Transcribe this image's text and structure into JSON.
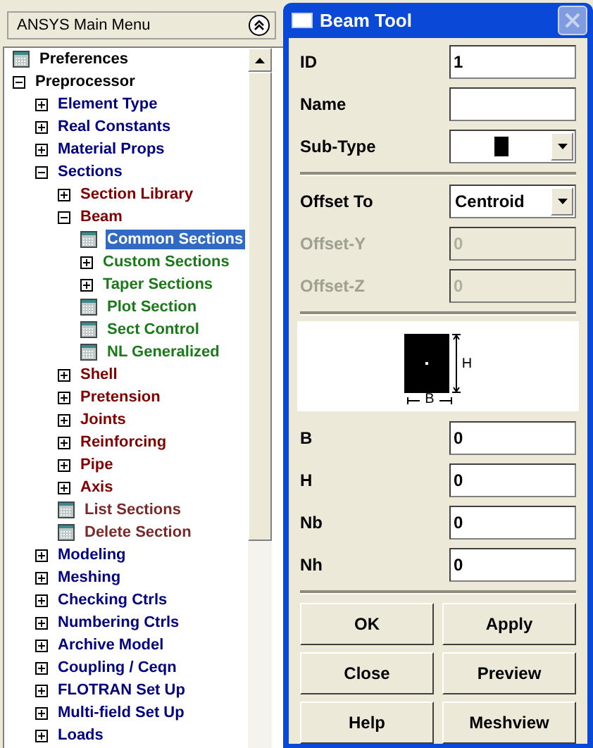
{
  "main_menu": {
    "title": "ANSYS Main Menu",
    "tree": [
      {
        "label": "Preferences",
        "kind": "action",
        "color": "#000000",
        "selected": false
      },
      {
        "label": "Preprocessor",
        "kind": "folder",
        "expanded": true,
        "color": "#000000",
        "selected": false,
        "children": [
          {
            "label": "Element Type",
            "kind": "folder",
            "expanded": false,
            "color": "#000080",
            "selected": false
          },
          {
            "label": "Real Constants",
            "kind": "folder",
            "expanded": false,
            "color": "#000080",
            "selected": false
          },
          {
            "label": "Material Props",
            "kind": "folder",
            "expanded": false,
            "color": "#000080",
            "selected": false
          },
          {
            "label": "Sections",
            "kind": "folder",
            "expanded": true,
            "color": "#000080",
            "selected": false,
            "children": [
              {
                "label": "Section Library",
                "kind": "folder",
                "expanded": false,
                "color": "#800000",
                "selected": false
              },
              {
                "label": "Beam",
                "kind": "folder",
                "expanded": true,
                "color": "#800000",
                "selected": false,
                "children": [
                  {
                    "label": "Common Sections",
                    "kind": "action",
                    "selected": true
                  },
                  {
                    "label": "Custom Sections",
                    "kind": "folder",
                    "expanded": false,
                    "color": "#1a7a1a",
                    "selected": false
                  },
                  {
                    "label": "Taper Sections",
                    "kind": "folder",
                    "expanded": false,
                    "color": "#1a7a1a",
                    "selected": false
                  },
                  {
                    "label": "Plot Section",
                    "kind": "action",
                    "color": "#1a7a1a",
                    "selected": false
                  },
                  {
                    "label": "Sect Control",
                    "kind": "action",
                    "color": "#1a7a1a",
                    "selected": false
                  },
                  {
                    "label": "NL Generalized",
                    "kind": "action",
                    "color": "#1a7a1a",
                    "selected": false
                  }
                ]
              },
              {
                "label": "Shell",
                "kind": "folder",
                "expanded": false,
                "color": "#800000",
                "selected": false
              },
              {
                "label": "Pretension",
                "kind": "folder",
                "expanded": false,
                "color": "#800000",
                "selected": false
              },
              {
                "label": "Joints",
                "kind": "folder",
                "expanded": false,
                "color": "#800000",
                "selected": false
              },
              {
                "label": "Reinforcing",
                "kind": "folder",
                "expanded": false,
                "color": "#800000",
                "selected": false
              },
              {
                "label": "Pipe",
                "kind": "folder",
                "expanded": false,
                "color": "#800000",
                "selected": false
              },
              {
                "label": "Axis",
                "kind": "folder",
                "expanded": false,
                "color": "#800000",
                "selected": false
              },
              {
                "label": "List Sections",
                "kind": "action",
                "color": "#7a2a2a",
                "selected": false
              },
              {
                "label": "Delete Section",
                "kind": "action",
                "color": "#7a2a2a",
                "selected": false
              }
            ]
          },
          {
            "label": "Modeling",
            "kind": "folder",
            "expanded": false,
            "color": "#000080",
            "selected": false
          },
          {
            "label": "Meshing",
            "kind": "folder",
            "expanded": false,
            "color": "#000080",
            "selected": false
          },
          {
            "label": "Checking Ctrls",
            "kind": "folder",
            "expanded": false,
            "color": "#000080",
            "selected": false
          },
          {
            "label": "Numbering Ctrls",
            "kind": "folder",
            "expanded": false,
            "color": "#000080",
            "selected": false
          },
          {
            "label": "Archive Model",
            "kind": "folder",
            "expanded": false,
            "color": "#000080",
            "selected": false
          },
          {
            "label": "Coupling / Ceqn",
            "kind": "folder",
            "expanded": false,
            "color": "#000080",
            "selected": false
          },
          {
            "label": "FLOTRAN Set Up",
            "kind": "folder",
            "expanded": false,
            "color": "#000080",
            "selected": false
          },
          {
            "label": "Multi-field Set Up",
            "kind": "folder",
            "expanded": false,
            "color": "#000080",
            "selected": false
          },
          {
            "label": "Loads",
            "kind": "folder",
            "expanded": false,
            "color": "#000080",
            "selected": false
          }
        ]
      }
    ]
  },
  "dialog": {
    "title": "Beam Tool",
    "top_fields": [
      {
        "label": "ID",
        "kind": "text",
        "value": "1",
        "disabled": false
      },
      {
        "label": "Name",
        "kind": "text",
        "disabled": false
      },
      {
        "label": "Sub-Type",
        "kind": "shape_dropdown",
        "disabled": false
      }
    ],
    "offset_fields": [
      {
        "label": "Offset To",
        "kind": "dropdown",
        "value": "Centroid",
        "disabled": false
      },
      {
        "label": "Offset-Y",
        "kind": "text",
        "value": "0",
        "disabled": true
      },
      {
        "label": "Offset-Z",
        "kind": "text",
        "value": "0",
        "disabled": true
      }
    ],
    "diagram": {
      "height_label": "H",
      "width_label": "B"
    },
    "dimension_fields": [
      {
        "label": "B",
        "kind": "text",
        "value": "0",
        "disabled": false
      },
      {
        "label": "H",
        "kind": "text",
        "value": "0",
        "disabled": false
      },
      {
        "label": "Nb",
        "kind": "text",
        "value": "0",
        "disabled": false
      },
      {
        "label": "Nh",
        "kind": "text",
        "value": "0",
        "disabled": false
      }
    ],
    "buttons": [
      "OK",
      "Apply",
      "Close",
      "Preview",
      "Help",
      "Meshview"
    ]
  }
}
